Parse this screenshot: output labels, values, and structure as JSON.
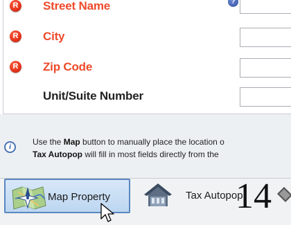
{
  "form": {
    "rows": [
      {
        "label": "Street Name",
        "required": true,
        "required_badge": "R",
        "help_badge": "?"
      },
      {
        "label": "City",
        "required": true,
        "required_badge": "R"
      },
      {
        "label": "Zip Code",
        "required": true,
        "required_badge": "R"
      },
      {
        "label": "Unit/Suite Number",
        "required": false
      }
    ]
  },
  "info": {
    "icon_glyph": "i",
    "line1_prefix": "Use the ",
    "line1_bold": "Map",
    "line1_suffix": " button to manually place the location o",
    "line2_bold": "Tax Autopop",
    "line2_suffix": " will fill in most fields directly from the"
  },
  "buttons": {
    "map_property": "Map Property",
    "tax_autopop": "Tax Autopop"
  },
  "overlay_number": "14",
  "colors": {
    "required_red": "#ee4a2a",
    "button_blue": "#5b87bf",
    "info_blue": "#4b73b5"
  }
}
